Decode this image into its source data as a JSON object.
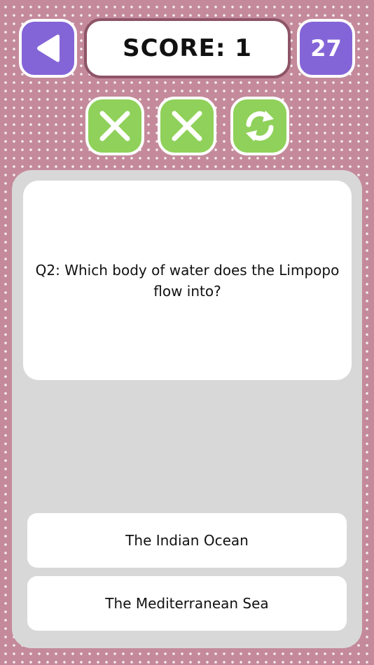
{
  "header": {
    "back_icon": "back-triangle-icon",
    "score_label": "SCORE: 1",
    "timer_value": "27"
  },
  "lifelines": [
    {
      "icon": "close-icon"
    },
    {
      "icon": "close-icon"
    },
    {
      "icon": "refresh-icon"
    }
  ],
  "question": {
    "text": "Q2: Which body of water does the Limpopo flow into?"
  },
  "answers": [
    {
      "label": "The Indian Ocean"
    },
    {
      "label": "The Mediterranean Sea"
    }
  ],
  "colors": {
    "background": "#c48a9c",
    "accent_purple": "#8465d8",
    "accent_green": "#8fd15a",
    "score_border": "#8e5468",
    "panel": "#d8d8d8"
  }
}
